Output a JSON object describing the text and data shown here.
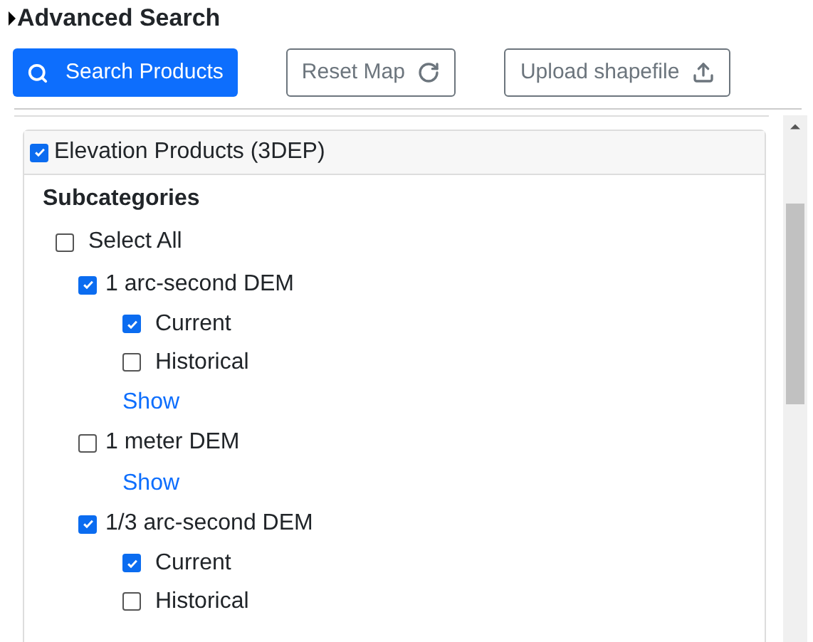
{
  "title": "Advanced Search",
  "buttons": [
    {
      "kind": "search",
      "label": "Search Products"
    },
    {
      "kind": "reset",
      "label": "Reset Map"
    },
    {
      "kind": "upload",
      "label": "Upload shapefile"
    }
  ],
  "category": {
    "label": "Elevation Products (3DEP)",
    "checked": true,
    "subcategories_heading": "Subcategories",
    "select_all": {
      "label": "Select All",
      "checked": false
    },
    "items": [
      {
        "label": "1 arc-second DEM",
        "checked": true,
        "children": [
          {
            "label": "Current",
            "checked": true
          },
          {
            "label": "Historical",
            "checked": false
          }
        ],
        "link": "Show"
      },
      {
        "label": "1 meter DEM",
        "checked": false,
        "link": "Show"
      },
      {
        "label": "1/3 arc-second DEM",
        "checked": true,
        "children": [
          {
            "label": "Current",
            "checked": true
          },
          {
            "label": "Historical",
            "checked": false
          }
        ]
      }
    ]
  }
}
